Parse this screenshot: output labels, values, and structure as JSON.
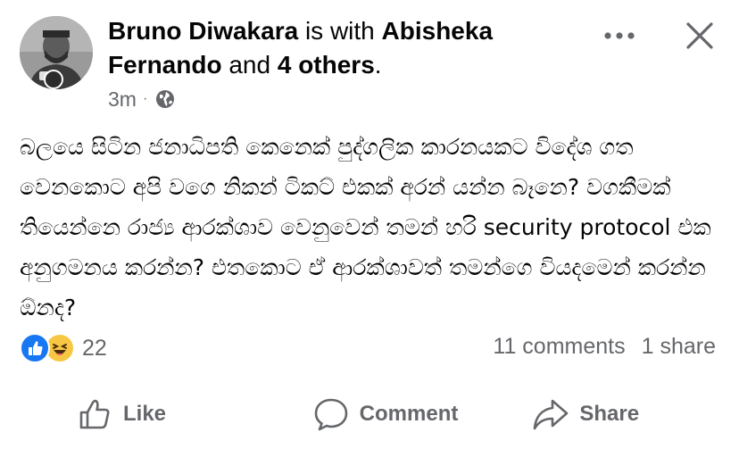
{
  "post": {
    "author": "Bruno Diwakara",
    "with_connector": "is with",
    "tagged": "Abisheka Fernando",
    "and_connector": "and",
    "others": "4 others",
    "period": ".",
    "time": "3m",
    "separator": "·",
    "audience_icon": "globe-icon",
    "text": "බලයෙ සිටින ජනාධිපති කෙනෙක් පුද්ගලික කාරනයකට විදේශ ගත වෙනකොට අපි වගෙ නිකන් ටිකට් එකක් අරන් යන්න බෑනෙ? වගකීමක් තියෙන්නෙ රාජ්‍ය ආරක්ශාව වෙනුවෙන් තමන් හරි security protocol එක අනුගමනය කරන්න? එතකොට ඒ ආරක්ශාවත් තමන්ගෙ වියදමෙන් කරන්න ඕනද?"
  },
  "header_actions": {
    "more_icon": "more-horizontal-icon",
    "close_icon": "close-icon"
  },
  "engagement": {
    "reaction_icons": [
      "like-reaction-icon",
      "haha-reaction-icon"
    ],
    "reaction_count": "22",
    "comments": "11 comments",
    "shares": "1 share"
  },
  "actions": {
    "like": "Like",
    "comment": "Comment",
    "share": "Share"
  },
  "colors": {
    "text": "#050505",
    "secondary": "#65676b",
    "like_blue": "#1877f2",
    "haha_yellow": "#f7c744"
  }
}
